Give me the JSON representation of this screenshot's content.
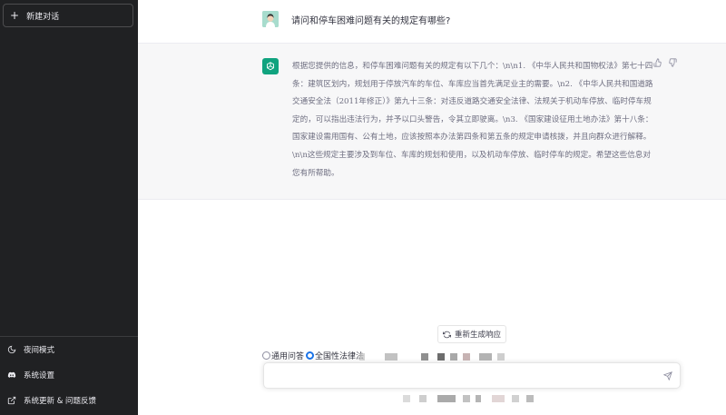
{
  "sidebar": {
    "new_chat": "新建对话",
    "bottom_items": [
      {
        "label": "夜间模式",
        "icon": "moon-icon"
      },
      {
        "label": "系统设置",
        "icon": "discord-icon"
      },
      {
        "label": "系统更新 & 问题反馈",
        "icon": "external-link-icon"
      }
    ]
  },
  "conversation": {
    "question": "请问和停车困难问题有关的规定有哪些?",
    "answer": "根据您提供的信息，和停车困难问题有关的规定有以下几个：\\n\\n1. 《中华人民共和国物权法》第七十四条：建筑区划内，规划用于停放汽车的车位、车库应当首先满足业主的需要。\\n2. 《中华人民共和国道路交通安全法（2011年修正）》第九十三条：对违反道路交通安全法律、法规关于机动车停放、临时停车规定的，可以指出违法行为，并予以口头警告，令其立即驶离。\\n3. 《国家建设征用土地办法》第十八条：国家建设需用国有、公有土地，应该按照本办法第四条和第五条的规定申请核拨，并且向群众进行解释。\\n\\n这些规定主要涉及到车位、车库的规划和使用，以及机动车停放、临时停车的规定。希望这些信息对您有所帮助。"
  },
  "controls": {
    "regenerate": "重新生成响应",
    "modes": [
      {
        "label": "通用问答",
        "selected": false
      },
      {
        "label": "全国性法律法",
        "selected": true
      }
    ],
    "input_value": "",
    "input_placeholder": ""
  },
  "colors": {
    "sidebar_bg": "#202123",
    "answer_bg": "#f7f7f8",
    "bot_avatar": "#10a37f",
    "radio_selected": "#1a73e8"
  }
}
